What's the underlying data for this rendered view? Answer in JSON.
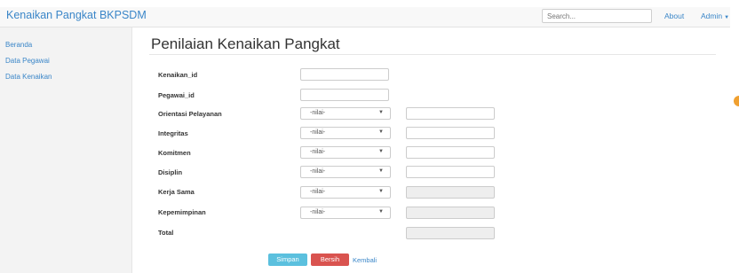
{
  "navbar": {
    "brand": "Kenaikan Pangkat BKPSDM",
    "search_placeholder": "Search...",
    "about": "About",
    "admin": "Admin",
    "admin_caret": "▼"
  },
  "sidebar": {
    "items": [
      {
        "label": "Beranda"
      },
      {
        "label": "Data Pegawai"
      },
      {
        "label": "Data Kenaikan"
      }
    ]
  },
  "page": {
    "title": "Penilaian Kenaikan Pangkat"
  },
  "form": {
    "fields": [
      {
        "label": "Kenaikan_id"
      },
      {
        "label": "Pegawai_id"
      },
      {
        "label": "Orientasi Pelayanan",
        "select": "-nilai-"
      },
      {
        "label": "Integritas",
        "select": "-nilai-"
      },
      {
        "label": "Komitmen",
        "select": "-nilai-"
      },
      {
        "label": "Disiplin",
        "select": "-nilai-"
      },
      {
        "label": "Kerja Sama",
        "select": "-nilai-"
      },
      {
        "label": "Kepemimpinan",
        "select": "-nilai-"
      },
      {
        "label": "Total"
      }
    ],
    "select_caret": "▼"
  },
  "actions": {
    "save": "Simpan",
    "clear": "Bersih",
    "back": "Kembali"
  },
  "colors": {
    "brand": "#3a86c8",
    "save_button": "#5bc0de",
    "clear_button": "#d9534f"
  }
}
